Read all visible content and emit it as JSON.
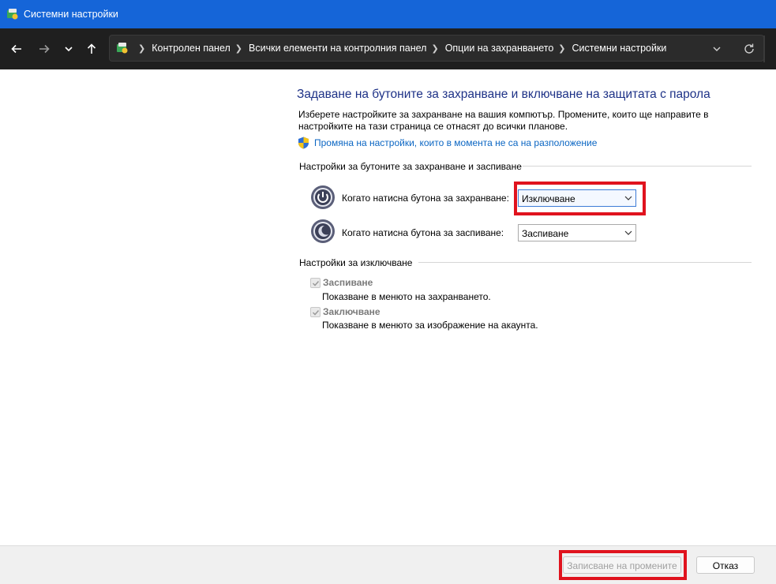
{
  "window": {
    "title": "Системни настройки"
  },
  "breadcrumb": {
    "items": [
      "Контролен панел",
      "Всички елементи на контролния панел",
      "Опции на захранването",
      "Системни настройки"
    ]
  },
  "main": {
    "heading": "Задаване на бутоните за захранване и включване на защитата с парола",
    "description": "Изберете настройките за захранване на вашия компютър. Промените, които ще направите в настройките на тази страница се отнасят до всички планове.",
    "change_settings_link": "Промяна на настройки, които в момента не са на разположение"
  },
  "buttons_group": {
    "label": "Настройки за бутоните за захранване и заспиване",
    "power_button": {
      "label": "Когато натисна бутона за захранване:",
      "selected": "Изключване"
    },
    "sleep_button": {
      "label": "Когато натисна бутона за заспиване:",
      "selected": "Заспиване"
    }
  },
  "shutdown_group": {
    "label": "Настройки за изключване",
    "items": [
      {
        "title": "Заспиване",
        "description": "Показване в менюто на захранването.",
        "checked": true
      },
      {
        "title": "Заключване",
        "description": "Показване в менюто за изображение на акаунта.",
        "checked": true
      }
    ]
  },
  "footer": {
    "save_label": "Записване на промените",
    "cancel_label": "Отказ"
  },
  "colors": {
    "titlebar": "#1565d8",
    "navbar": "#1f1f1f",
    "heading": "#1e3287",
    "link": "#0b66c3",
    "highlight": "#e0131e"
  }
}
